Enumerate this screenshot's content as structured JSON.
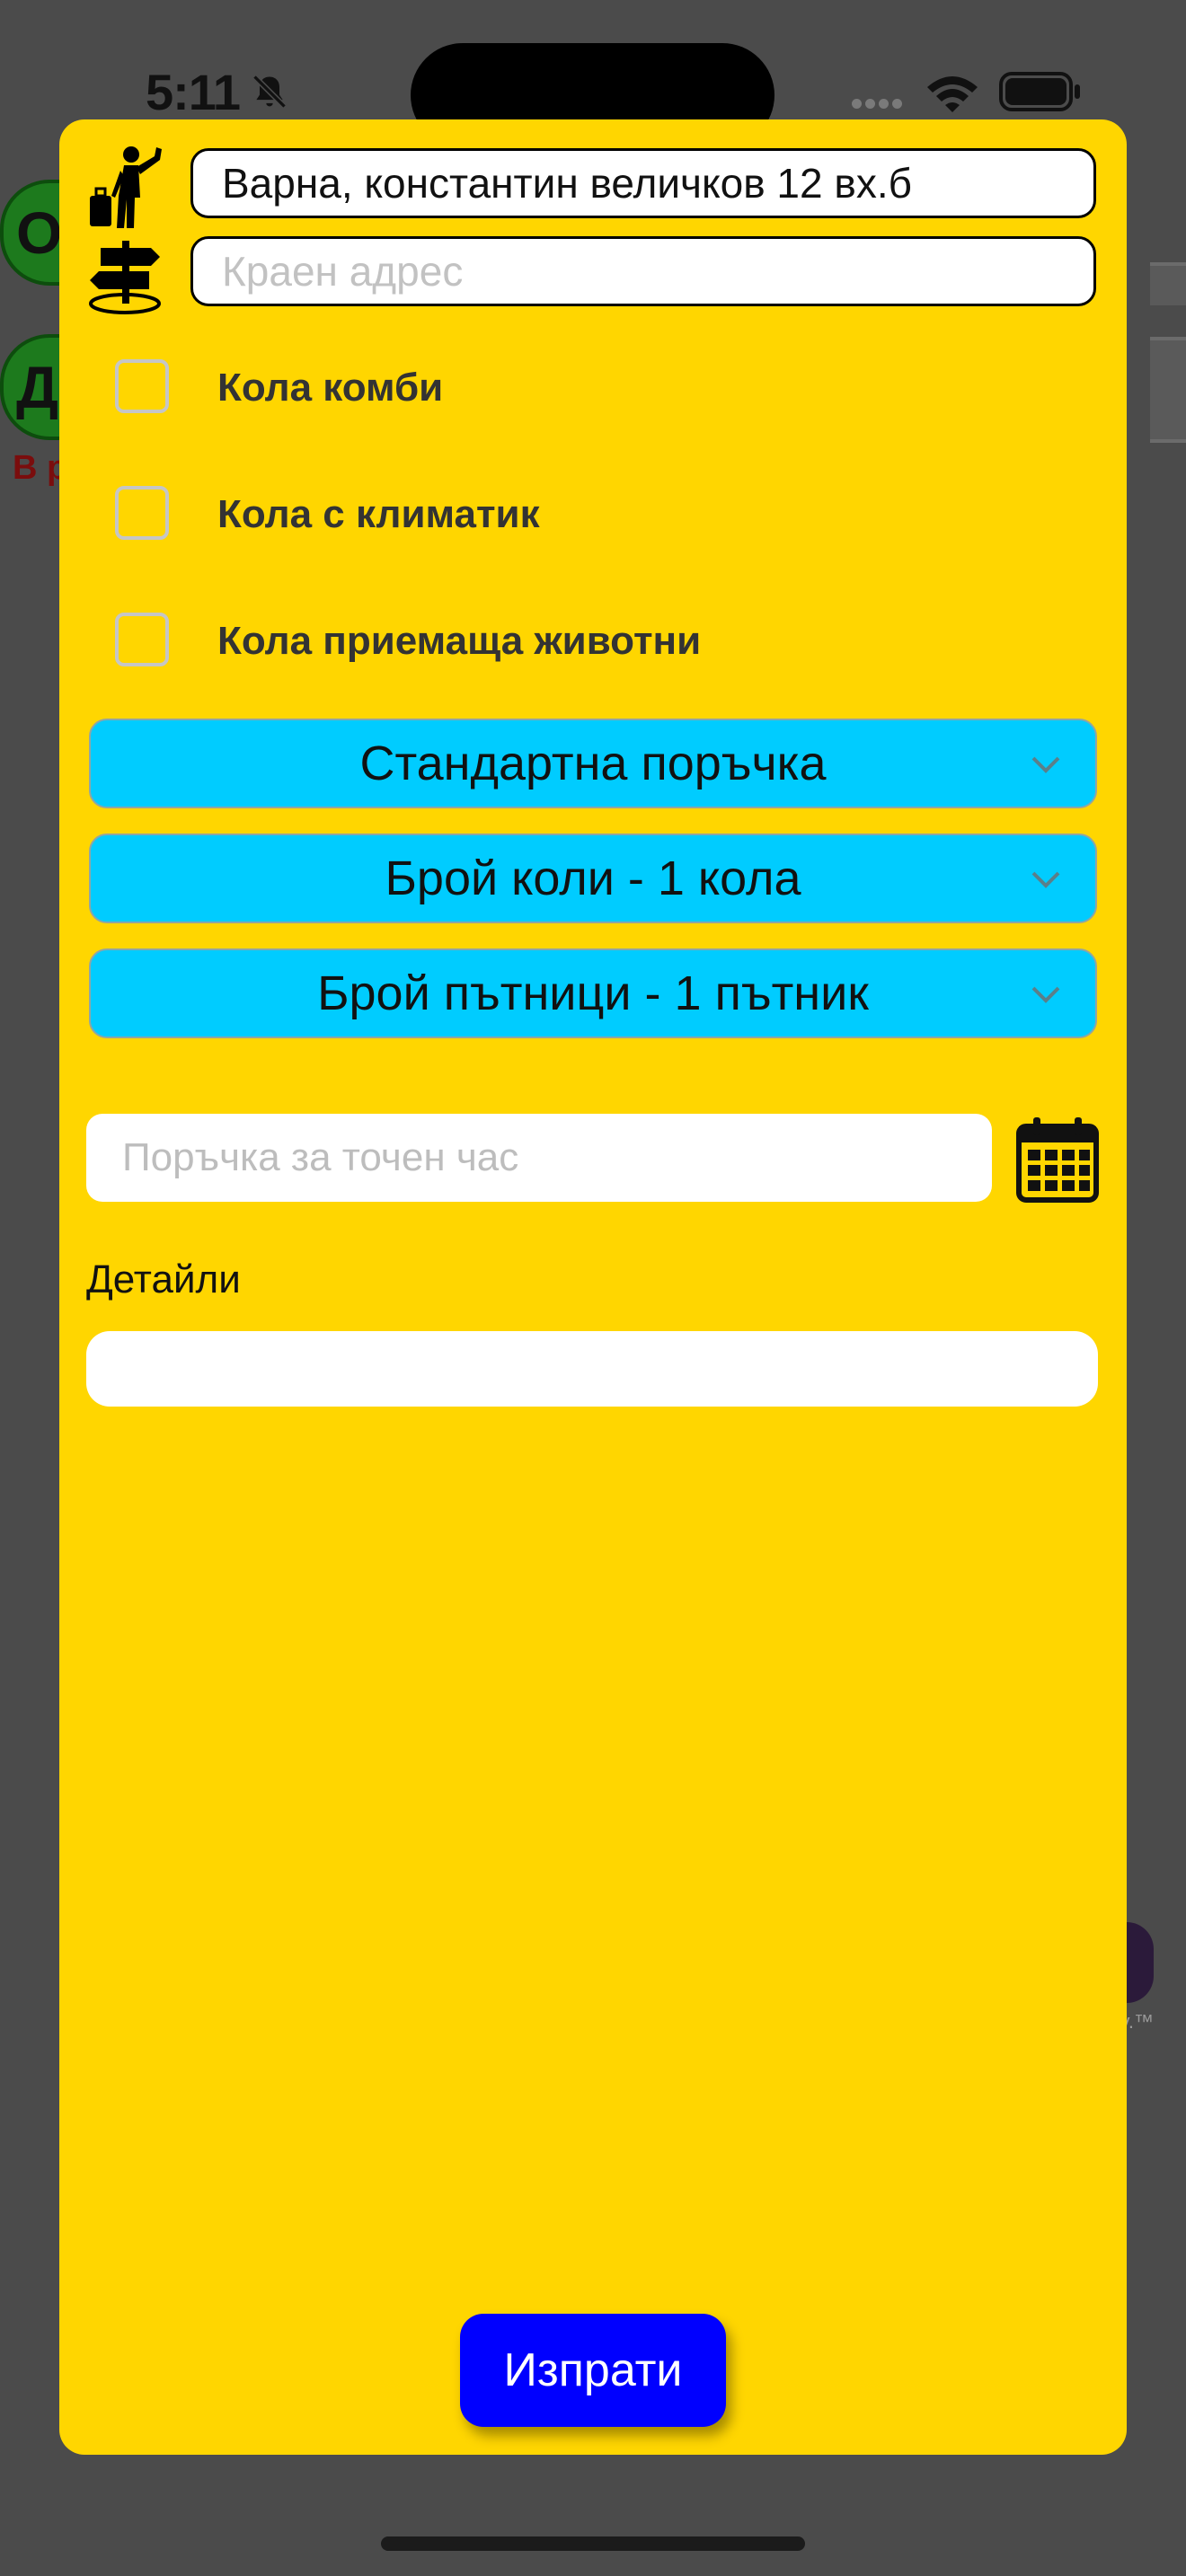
{
  "status_bar": {
    "time": "5:11"
  },
  "background": {
    "button_top_letter": "О",
    "button_bottom_letter": "Д",
    "red_text": "В р",
    "tm_text": "y.™"
  },
  "form": {
    "pickup_address": "Варна, константин величков 12 вх.б",
    "destination_placeholder": "Краен адрес",
    "options": [
      {
        "label": "Кола комби",
        "checked": false
      },
      {
        "label": "Кола с климатик",
        "checked": false
      },
      {
        "label": "Кола приемаща животни",
        "checked": false
      }
    ],
    "order_type": "Стандартна поръчка",
    "car_count": "Брой коли - 1 кола",
    "passenger_count": "Брой пътници - 1 пътник",
    "scheduled_time_placeholder": "Поръчка за точен час",
    "details_label": "Детайли",
    "details_value": "",
    "send_label": "Изпрати"
  },
  "colors": {
    "modal_bg": "#ffd600",
    "dropdown_bg": "#00ccff",
    "send_button_bg": "#0000ff",
    "overlay_bg": "#4b4b4b"
  },
  "icons": [
    "hitchhiker-icon",
    "signpost-icon",
    "chevron-down-icon",
    "calendar-icon",
    "bell-slash-icon",
    "wifi-icon",
    "battery-icon"
  ]
}
